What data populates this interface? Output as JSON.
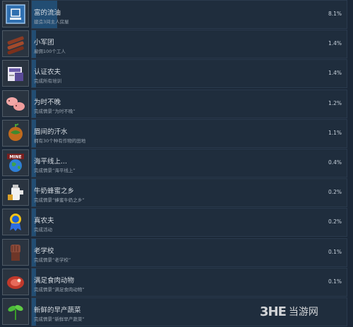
{
  "achievements": [
    {
      "title": "富的流油",
      "desc": "建造3间主人房屋",
      "pct": "8.1%",
      "fill": 0.081,
      "icon": "blueprint-icon"
    },
    {
      "title": "小军团",
      "desc": "雇佣100个工人",
      "pct": "1.4%",
      "fill": 0.014,
      "icon": "logs-icon"
    },
    {
      "title": "认证农夫",
      "desc": "完成所有培训",
      "pct": "1.4%",
      "fill": 0.014,
      "icon": "certificate-icon"
    },
    {
      "title": "为时不晚",
      "desc": "完成情景“为时不晚”",
      "pct": "1.2%",
      "fill": 0.012,
      "icon": "pigs-icon"
    },
    {
      "title": "眉间的汗水",
      "desc": "拥有30个种有作物的田地",
      "pct": "1.1%",
      "fill": 0.011,
      "icon": "globe-plant-icon"
    },
    {
      "title": "海平线上...",
      "desc": "完成情景“海平线上”",
      "pct": "0.4%",
      "fill": 0.004,
      "icon": "mine-earth-icon"
    },
    {
      "title": "牛奶蜂蜜之乡",
      "desc": "完成情景“蜂蜜牛奶之乡”",
      "pct": "0.2%",
      "fill": 0.002,
      "icon": "milk-jug-icon"
    },
    {
      "title": "真农夫",
      "desc": "完成活动",
      "pct": "0.2%",
      "fill": 0.002,
      "icon": "ribbon-icon"
    },
    {
      "title": "老学校",
      "desc": "完成情景“老学校”",
      "pct": "0.1%",
      "fill": 0.001,
      "icon": "fist-icon"
    },
    {
      "title": "满足食肉动物",
      "desc": "完成情景“满足食肉动物”",
      "pct": "0.1%",
      "fill": 0.001,
      "icon": "meat-icon"
    },
    {
      "title": "新鲜的早产蔬菜",
      "desc": "完成情景“新鲜早产蔬菜”",
      "pct": "",
      "fill": 0.001,
      "icon": "sprout-icon"
    }
  ],
  "mine_label": "MINE",
  "watermark": {
    "logo": "3HE",
    "text": "当游网"
  }
}
